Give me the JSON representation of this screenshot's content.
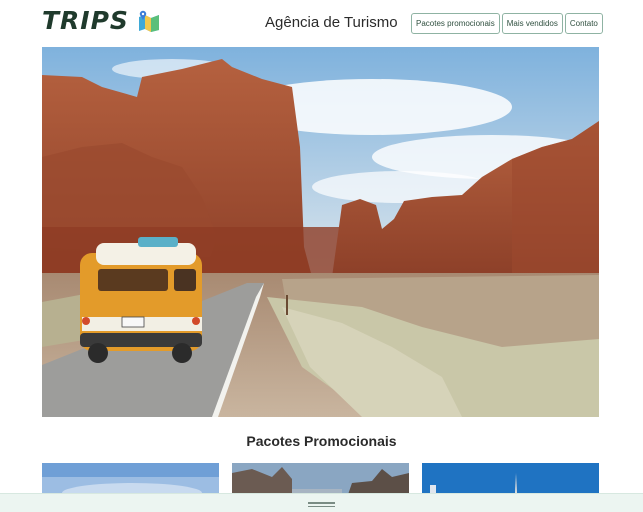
{
  "brand": {
    "name": "TRIPS",
    "icon": "map-icon"
  },
  "header": {
    "agency_title": "Agência de Turismo"
  },
  "nav": {
    "items": [
      {
        "label": "Pacotes promocionais"
      },
      {
        "label": "Mais vendidos"
      },
      {
        "label": "Contato"
      }
    ]
  },
  "hero": {
    "image": "van-on-desert-road-with-red-rock-formations"
  },
  "promos": {
    "title": "Pacotes Promocionais",
    "cards": [
      "sky-landscape",
      "city-street",
      "blue-sky-cityscape"
    ]
  },
  "colors": {
    "brand": "#1f3a2c",
    "nav_border": "#8fb3a3",
    "bottom_bar": "#ecf5f1"
  }
}
